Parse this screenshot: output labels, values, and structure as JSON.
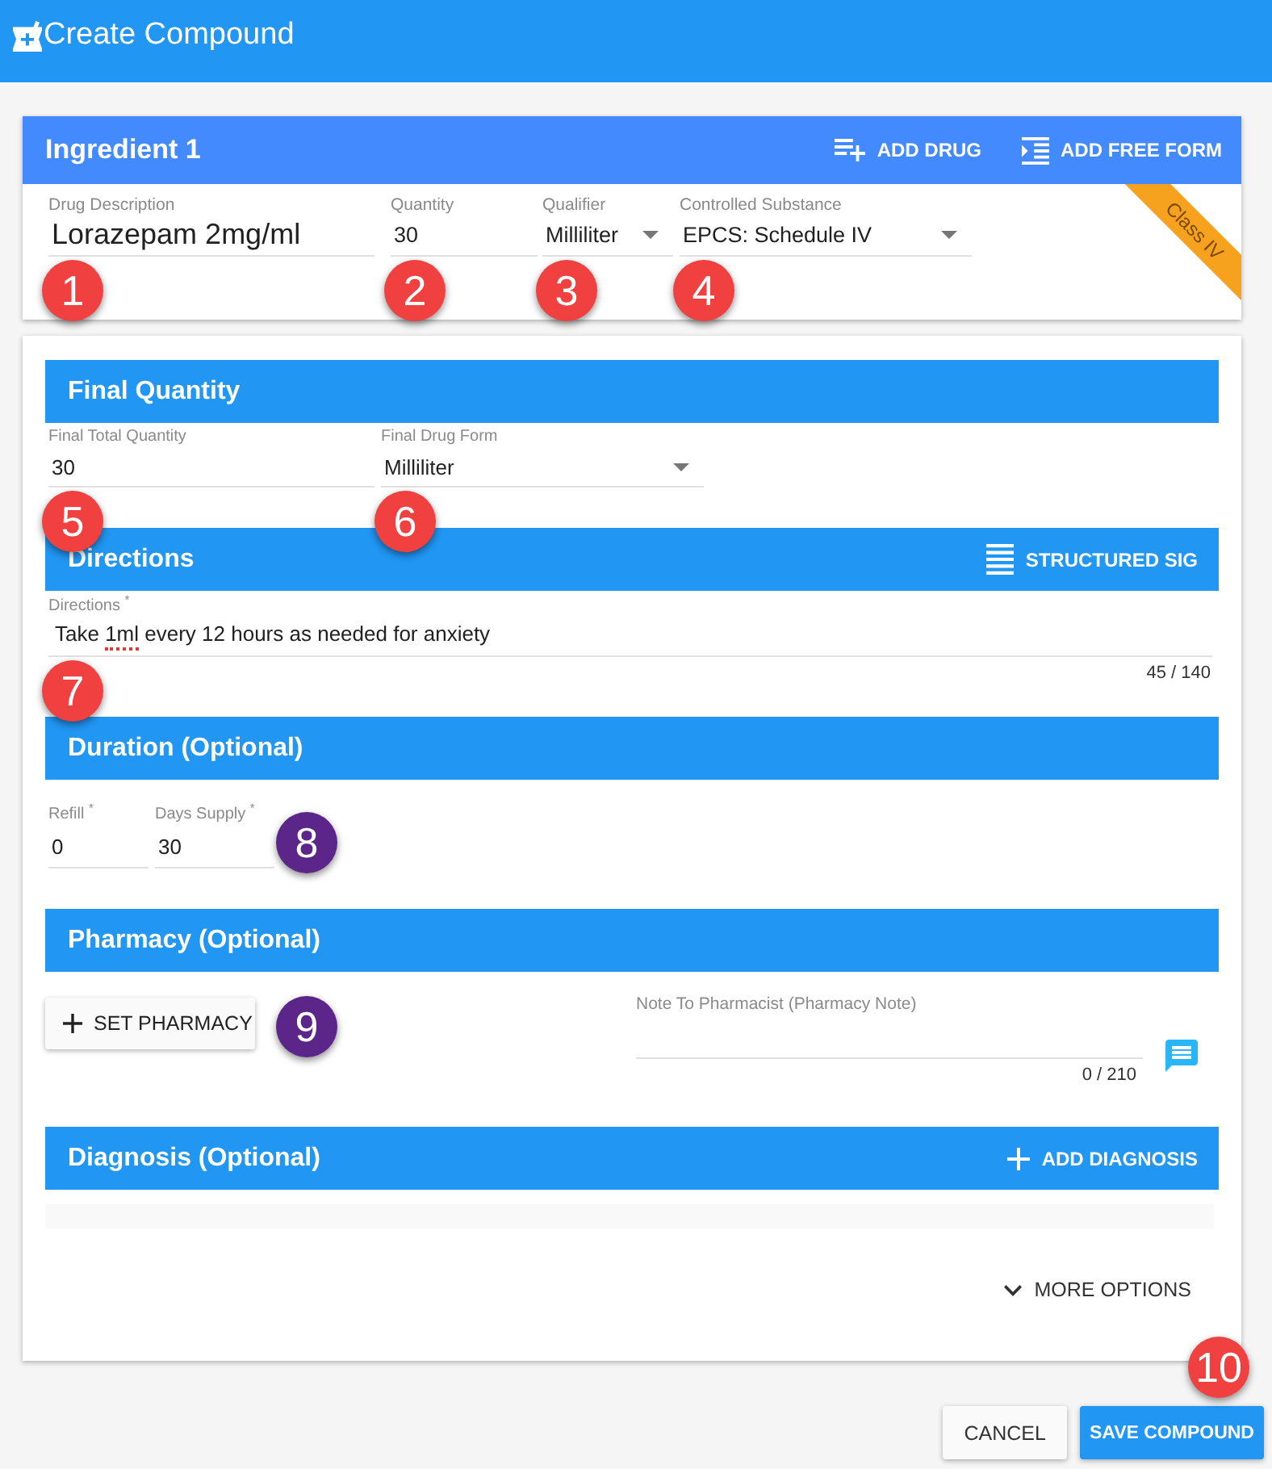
{
  "app_bar": {
    "title": "Create Compound"
  },
  "ingredient": {
    "title": "Ingredient 1",
    "actions": [
      {
        "kind": "add_drug",
        "label": "ADD DRUG"
      },
      {
        "kind": "add_free_form",
        "label": "ADD FREE FORM"
      }
    ],
    "ribbon": {
      "label": "Class IV"
    },
    "fields": [
      {
        "kind": "drug",
        "label": "Drug Description",
        "value": "Lorazepam 2mg/ml",
        "marker": {
          "number": "1",
          "color": "#f0403f"
        }
      },
      {
        "kind": "text",
        "label": "Quantity",
        "value": "30",
        "marker": {
          "number": "2",
          "color": "#f0403f"
        }
      },
      {
        "kind": "select",
        "label": "Qualifier",
        "value": "Milliliter",
        "marker": {
          "number": "3",
          "color": "#f0403f"
        }
      },
      {
        "kind": "select",
        "label": "Controlled Substance",
        "value": "EPCS: Schedule IV",
        "marker": {
          "number": "4",
          "color": "#f0403f"
        }
      }
    ]
  },
  "final_quantity": {
    "title": "Final Quantity",
    "fields": [
      {
        "kind": "text",
        "label": "Final Total Quantity",
        "value": "30",
        "marker": {
          "number": "5",
          "color": "#f0403f"
        }
      },
      {
        "kind": "select",
        "label": "Final Drug Form",
        "value": "Milliliter",
        "marker": {
          "number": "6",
          "color": "#f0403f"
        }
      }
    ]
  },
  "directions": {
    "title": "Directions",
    "action": {
      "label": "STRUCTURED SIG"
    },
    "field": {
      "label": "Directions $^{*}$",
      "value": [
        {
          "text": "Take ",
          "misspelled": false
        },
        {
          "text": "1ml",
          "misspelled": true
        },
        {
          "text": " every 12 hours as needed for anxiety",
          "misspelled": false
        }
      ],
      "counter": "45 / 140",
      "marker": {
        "number": "7",
        "color": "#f0403f"
      }
    }
  },
  "duration": {
    "title": "Duration (Optional)",
    "fields": [
      {
        "label": "Refill $^{*}$",
        "value": "0"
      },
      {
        "label": "Days Supply $^{*}$",
        "value": "30"
      }
    ],
    "marker": {
      "number": "8",
      "color": "#5c2589"
    }
  },
  "pharmacy": {
    "title": "Pharmacy (Optional)",
    "button": {
      "label": "SET PHARMACY",
      "marker": {
        "number": "9",
        "color": "#5c2589"
      }
    },
    "note": {
      "label": "Note To Pharmacist (Pharmacy Note)",
      "counter": "0 / 210"
    }
  },
  "diagnosis": {
    "title": "Diagnosis (Optional)",
    "action": {
      "label": "ADD DIAGNOSIS"
    }
  },
  "more_options": {
    "label": "MORE OPTIONS"
  },
  "footer": {
    "buttons": [
      {
        "kind": "cancel",
        "label": "CANCEL"
      },
      {
        "kind": "save",
        "label": "SAVE COMPOUND",
        "marker": {
          "number": "10",
          "color": "#f0403f"
        }
      }
    ]
  }
}
